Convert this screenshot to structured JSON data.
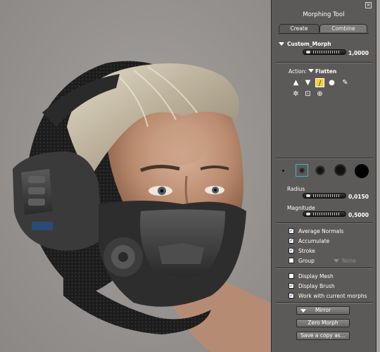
{
  "panel": {
    "close_glyph": "×",
    "title": "Morphing Tool",
    "tabs": [
      {
        "label": "Create",
        "active": true
      },
      {
        "label": "Combine",
        "active": false
      }
    ]
  },
  "morph": {
    "name": "Custom_Morph",
    "value": "1,0000"
  },
  "action": {
    "label": "Action:",
    "selected": "Flatten",
    "tool_icons": [
      "push-icon",
      "pull-icon",
      "flatten-icon",
      "smooth-icon",
      "restore-icon",
      "tack-icon",
      "pinch-icon",
      "magnify-icon"
    ]
  },
  "brush": {
    "radius_label": "Radius",
    "radius_value": "0,0150",
    "magnitude_label": "Magnitude",
    "magnitude_value": "0,5000"
  },
  "options": [
    {
      "label": "Average Normals",
      "checked": true
    },
    {
      "label": "Accumulate",
      "checked": true
    },
    {
      "label": "Stroke",
      "checked": true
    },
    {
      "label": "Group",
      "checked": false,
      "group_value": "None"
    }
  ],
  "display": [
    {
      "label": "Display Mesh",
      "checked": false
    },
    {
      "label": "Display Brush",
      "checked": true
    },
    {
      "label": "Work with current morphs",
      "checked": true
    }
  ],
  "buttons": {
    "mirror": "Mirror",
    "zero": "Zero Morph",
    "save": "Save a copy as..."
  },
  "colors": {
    "panel_bg": "#5c5a58",
    "checkmark": "#2a4f9a",
    "selected_tool": "#f0d040"
  }
}
